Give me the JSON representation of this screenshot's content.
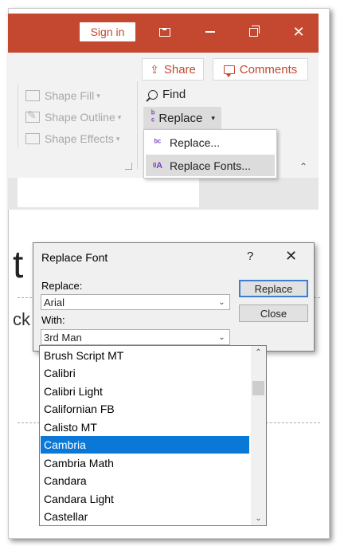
{
  "titlebar": {
    "signin_label": "Sign in",
    "ribbon_display_icon": "ribbon-display-icon",
    "minimize_icon": "minimize-icon",
    "restore_icon": "restore-icon",
    "close_glyph": "✕"
  },
  "ribbon": {
    "share_label": "Share",
    "comments_label": "Comments",
    "shape_fill": "Shape Fill",
    "shape_outline": "Shape Outline",
    "shape_effects": "Shape Effects",
    "find_label": "Find",
    "replace_label": "Replace",
    "menu": {
      "replace_item": "Replace...",
      "replace_fonts_item": "Replace Fonts..."
    }
  },
  "dialog": {
    "title": "Replace Font",
    "help": "?",
    "close": "✕",
    "replace_label": "Replace:",
    "replace_value": "Arial",
    "with_label": "With:",
    "with_value": "3rd Man",
    "replace_button": "Replace",
    "close_button": "Close"
  },
  "font_list": {
    "items": [
      "Brush Script MT",
      "Calibri",
      "Calibri Light",
      "Californian FB",
      "Calisto MT",
      "Cambria",
      "Cambria Math",
      "Candara",
      "Candara Light",
      "Castellar"
    ],
    "selected": "Cambria"
  },
  "slide": {
    "big_letter": "t",
    "partial_text": "ck"
  },
  "colors": {
    "accent": "#c4472f",
    "selection": "#0a78d7"
  }
}
